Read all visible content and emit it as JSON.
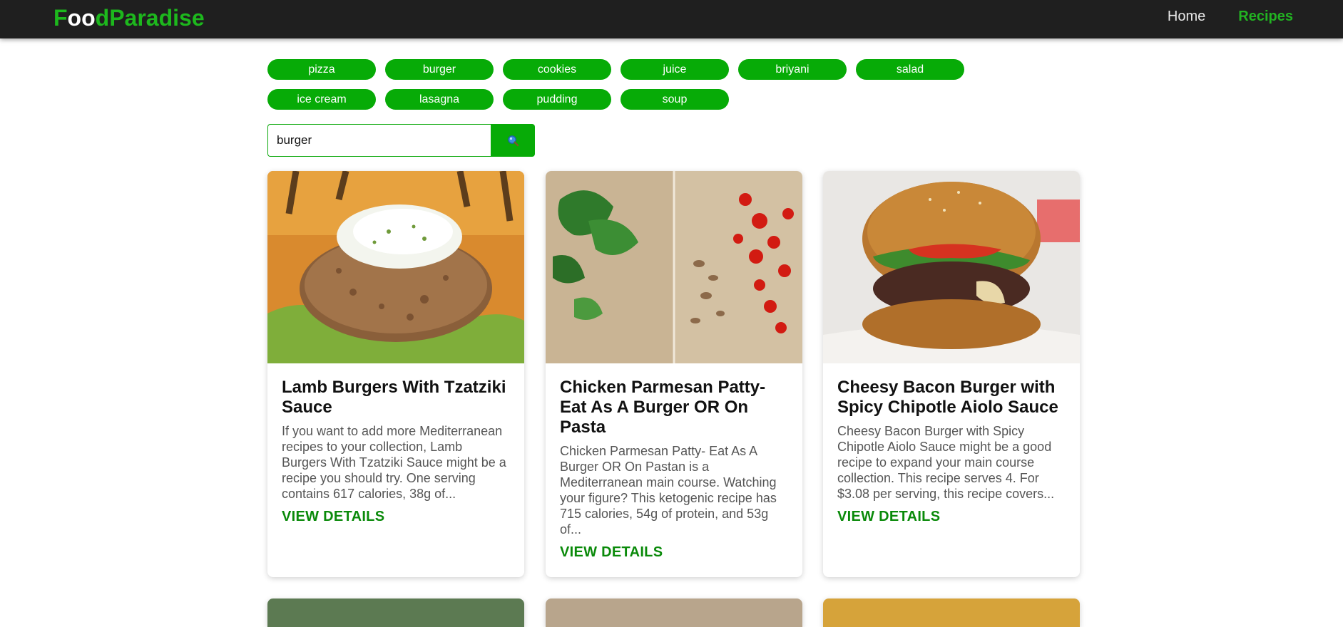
{
  "nav": {
    "logo_parts": [
      "F",
      "oo",
      "d",
      "Paradise"
    ],
    "links": [
      {
        "label": "Home",
        "active": false
      },
      {
        "label": "Recipes",
        "active": true
      }
    ]
  },
  "chips": [
    "pizza",
    "burger",
    "cookies",
    "juice",
    "briyani",
    "salad",
    "ice cream",
    "lasagna",
    "pudding",
    "soup"
  ],
  "search": {
    "value": "burger",
    "icon": "search-icon"
  },
  "cards": [
    {
      "title": "Lamb Burgers With Tzatziki Sauce",
      "description": "If you want to add more Mediterranean recipes to your collection, Lamb Burgers With Tzatziki Sauce might be a recipe you should try. One serving contains 617 calories, 38g of...",
      "link": "VIEW DETAILS"
    },
    {
      "title": "Chicken Parmesan Patty- Eat As A Burger OR On Pasta",
      "description": "Chicken Parmesan Patty- Eat As A Burger OR On Pastan is a Mediterranean main course. Watching your figure? This ketogenic recipe has 715 calories, 54g of protein, and 53g of...",
      "link": "VIEW DETAILS"
    },
    {
      "title": "Cheesy Bacon Burger with Spicy Chipotle Aiolo Sauce",
      "description": "Cheesy Bacon Burger with Spicy Chipotle Aiolo Sauce might be a good recipe to expand your main course collection. This recipe serves 4. For $3.08 per serving, this recipe covers...",
      "link": "VIEW DETAILS"
    }
  ],
  "colors": {
    "accent": "#07ab07",
    "navbar": "#1f1f1f",
    "link": "#0a8a0a"
  }
}
